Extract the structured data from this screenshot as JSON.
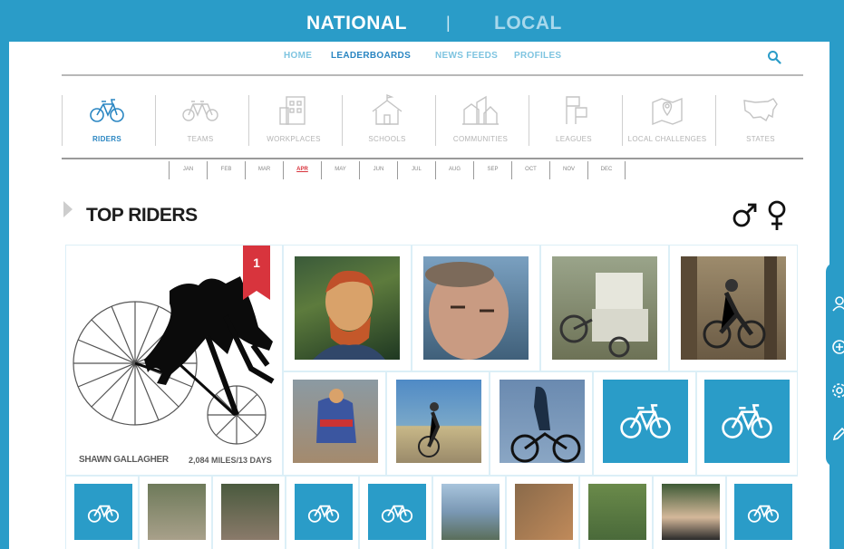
{
  "topnav": {
    "national": "NATIONAL",
    "separator": "|",
    "local": "LOCAL"
  },
  "subnav": {
    "home": "HOME",
    "leaderboards": "LEADERBOARDS",
    "news_feeds": "NEWS FEEDS",
    "profiles": "PROFILES",
    "search_icon": "search-icon"
  },
  "categories": [
    {
      "label": "RIDERS",
      "icon": "bike-icon",
      "active": true
    },
    {
      "label": "TEAMS",
      "icon": "tandem-bike-icon"
    },
    {
      "label": "WORKPLACES",
      "icon": "building-icon"
    },
    {
      "label": "SCHOOLS",
      "icon": "school-icon"
    },
    {
      "label": "COMMUNITIES",
      "icon": "houses-icon"
    },
    {
      "label": "LEAGUES",
      "icon": "flags-icon"
    },
    {
      "label": "LOCAL CHALLENGES",
      "icon": "map-pin-icon"
    },
    {
      "label": "STATES",
      "icon": "usa-map-icon"
    }
  ],
  "months": [
    "JAN",
    "FEB",
    "MAR",
    "APR",
    "MAY",
    "JUN",
    "JUL",
    "AUG",
    "SEP",
    "OCT",
    "NOV",
    "DEC"
  ],
  "active_month": "APR",
  "section_title": "TOP RIDERS",
  "gender_filters": {
    "male": "male-icon",
    "female": "female-icon"
  },
  "featured": {
    "rank": "1",
    "name": "SHAWN GALLAGHER",
    "stat": "2,084 MILES/13 DAYS"
  },
  "colors": {
    "brand": "#2a9cc8",
    "rank_red": "#d8343d"
  }
}
